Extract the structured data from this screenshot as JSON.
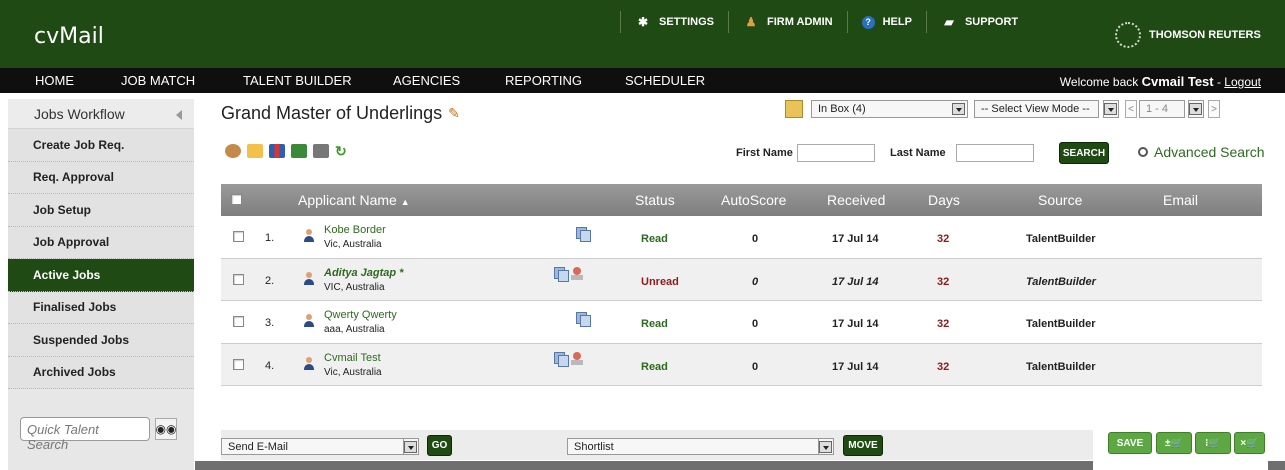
{
  "app": {
    "name": "cvMail",
    "brand": "THOMSON REUTERS"
  },
  "top_links": [
    {
      "label": "SETTINGS",
      "icon": "gear-icon"
    },
    {
      "label": "FIRM ADMIN",
      "icon": "person-icon"
    },
    {
      "label": "HELP",
      "icon": "help-icon"
    },
    {
      "label": "SUPPORT",
      "icon": "chat-icon"
    }
  ],
  "nav": {
    "items": [
      "HOME",
      "JOB MATCH",
      "TALENT BUILDER",
      "AGENCIES",
      "REPORTING",
      "SCHEDULER"
    ],
    "welcome": "Welcome back",
    "user": "Cvmail Test",
    "separator": " - ",
    "logout": "Logout"
  },
  "sidebar": {
    "title": "Jobs Workflow",
    "items": [
      "Create Job Req.",
      "Req. Approval",
      "Job Setup",
      "Job Approval",
      "Active Jobs",
      "Finalised Jobs",
      "Suspended Jobs",
      "Archived Jobs"
    ],
    "active": "Active Jobs",
    "quick_search_placeholder": "Quick Talent Search"
  },
  "main": {
    "title": "Grand Master of Underlings",
    "inbox_select": "In Box (4)",
    "view_mode_select": "-- Select View Mode --",
    "pager": {
      "prev": "<",
      "range": "1 - 4",
      "next": ">"
    },
    "first_name_label": "First Name",
    "last_name_label": "Last Name",
    "search_button": "SEARCH",
    "advanced_search": "Advanced Search"
  },
  "table": {
    "columns": [
      "Applicant Name",
      "Status",
      "AutoScore",
      "Received",
      "Days",
      "Source",
      "Email"
    ],
    "sort_indicator": "▲",
    "rows": [
      {
        "num": "1.",
        "name": "Kobe Border",
        "location": "Vic, Australia",
        "status": "Read",
        "autoscore": "0",
        "received": "17 Jul 14",
        "days": "32",
        "source": "TalentBuilder",
        "unread": false,
        "flag": false
      },
      {
        "num": "2.",
        "name": "Aditya Jagtap *",
        "location": "VIC, Australia",
        "status": "Unread",
        "autoscore": "0",
        "received": "17 Jul 14",
        "days": "32",
        "source": "TalentBuilder",
        "unread": true,
        "flag": true
      },
      {
        "num": "3.",
        "name": "Qwerty Qwerty",
        "location": "aaa, Australia",
        "status": "Read",
        "autoscore": "0",
        "received": "17 Jul 14",
        "days": "32",
        "source": "TalentBuilder",
        "unread": false,
        "flag": false
      },
      {
        "num": "4.",
        "name": "Cvmail Test",
        "location": "Vic, Australia",
        "status": "Read",
        "autoscore": "0",
        "received": "17 Jul 14",
        "days": "32",
        "source": "TalentBuilder",
        "unread": false,
        "flag": true
      }
    ]
  },
  "bottom": {
    "action_select": "Send E-Mail",
    "go_button": "GO",
    "list_select": "Shortlist",
    "move_button": "MOVE",
    "save_button": "SAVE"
  },
  "colors": {
    "header_green": "#1f4a13",
    "nav_black": "#0f0f0f",
    "action_green": "#5ea844",
    "status_red": "#8e1a1a"
  }
}
